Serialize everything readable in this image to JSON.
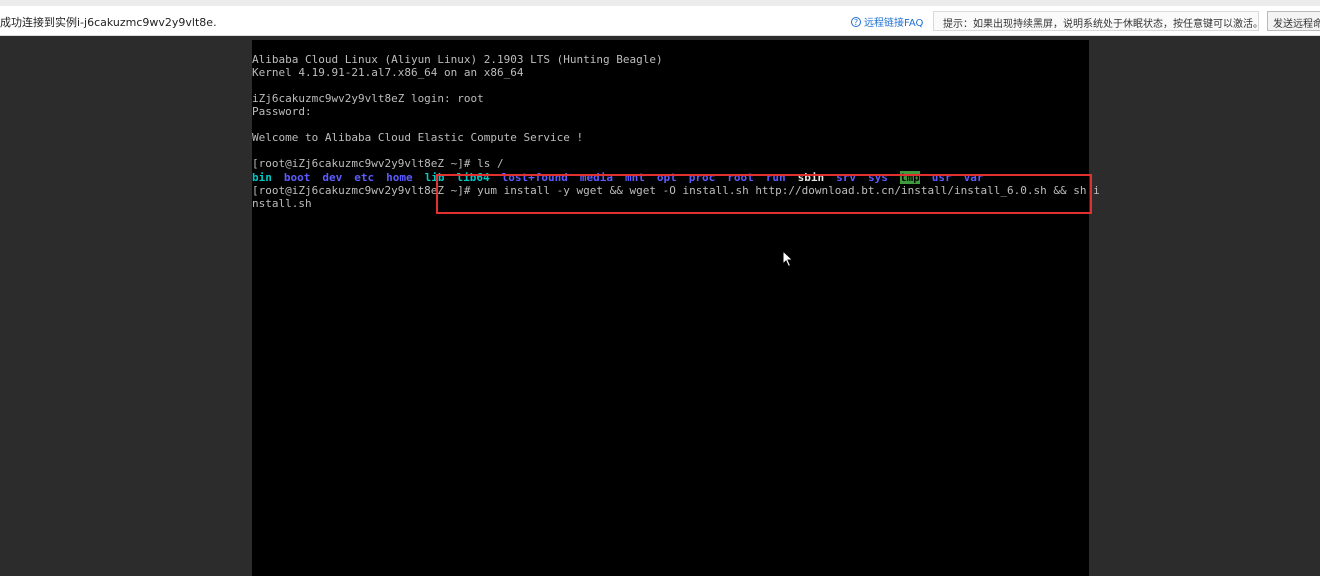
{
  "topbar": {
    "status": "成功连接到实例i-j6cakuzmc9wv2y9vlt8e.",
    "faq_label": "远程链接FAQ",
    "hint": "提示：如果出现持续黑屏，说明系统处于休眠状态，按任意键可以激活。",
    "cmd_button": "发送远程命令"
  },
  "terminal": {
    "lines": [
      "Alibaba Cloud Linux (Aliyun Linux) 2.1903 LTS (Hunting Beagle)",
      "Kernel 4.19.91-21.al7.x86_64 on an x86_64",
      "",
      "iZj6cakuzmc9wv2y9vlt8eZ login: root",
      "Password:",
      "",
      "Welcome to Alibaba Cloud Elastic Compute Service !",
      "",
      "[root@iZj6cakuzmc9wv2y9vlt8eZ ~]# ls /"
    ],
    "ls_entries": [
      {
        "name": "bin",
        "kind": "link"
      },
      {
        "name": "boot",
        "kind": "dir"
      },
      {
        "name": "dev",
        "kind": "dir"
      },
      {
        "name": "etc",
        "kind": "dir"
      },
      {
        "name": "home",
        "kind": "dir"
      },
      {
        "name": "lib",
        "kind": "link"
      },
      {
        "name": "lib64",
        "kind": "link"
      },
      {
        "name": "lost+found",
        "kind": "dir"
      },
      {
        "name": "media",
        "kind": "dir"
      },
      {
        "name": "mnt",
        "kind": "dir"
      },
      {
        "name": "opt",
        "kind": "dir"
      },
      {
        "name": "proc",
        "kind": "dir"
      },
      {
        "name": "root",
        "kind": "dir"
      },
      {
        "name": "run",
        "kind": "dir"
      },
      {
        "name": "sbin",
        "kind": "plain"
      },
      {
        "name": "srv",
        "kind": "dir"
      },
      {
        "name": "sys",
        "kind": "dir"
      },
      {
        "name": "tmp",
        "kind": "tmp"
      },
      {
        "name": "usr",
        "kind": "dir"
      },
      {
        "name": "var",
        "kind": "dir"
      }
    ],
    "prompt_line": "[root@iZj6cakuzmc9wv2y9vlt8eZ ~]# yum install -y wget && wget -O install.sh http://download.bt.cn/install/install_6.0.sh && sh i",
    "wrap_line": "nstall.sh"
  },
  "colors": {
    "highlight": "#e03030",
    "link_blue": "#1d6fd1"
  }
}
